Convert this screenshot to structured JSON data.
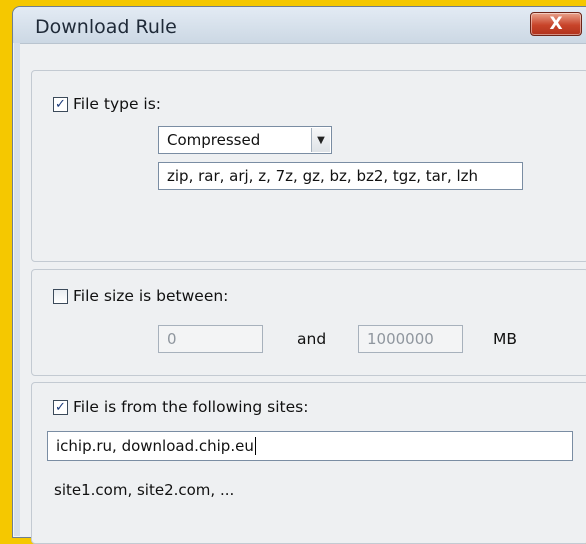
{
  "window": {
    "title": "Download Rule",
    "close_glyph": "X"
  },
  "file_type": {
    "checked": true,
    "label": "File type is:",
    "type_value": "Compressed",
    "extensions": "zip, rar, arj, z, 7z, gz, bz, bz2, tgz, tar, lzh"
  },
  "file_size": {
    "checked": false,
    "label": "File size is between:",
    "min": "0",
    "and_label": "and",
    "max": "1000000",
    "unit": "MB"
  },
  "sites": {
    "checked": true,
    "label": "File is from the following sites:",
    "value": "ichip.ru, download.chip.eu",
    "hint": "site1.com, site2.com, ..."
  },
  "icons": {
    "check": "check-icon",
    "dropdown": "chevron-down-icon",
    "close": "close-icon"
  }
}
